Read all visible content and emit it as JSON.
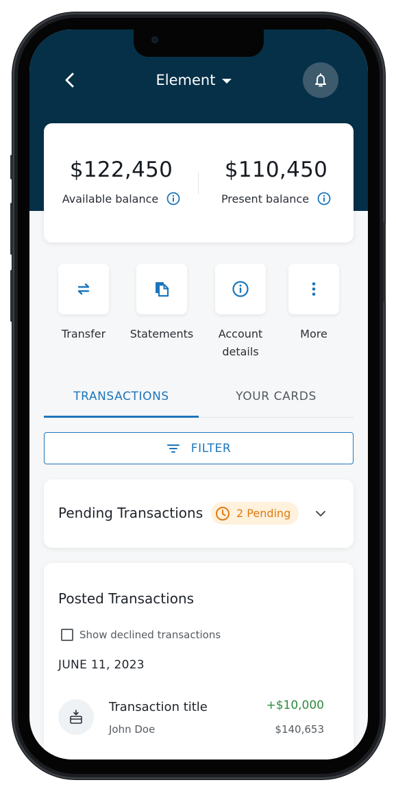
{
  "header": {
    "title": "Element",
    "back_icon": "chevron-left-icon",
    "dropdown_icon": "caret-down-icon",
    "bell_icon": "bell-icon"
  },
  "balances": {
    "available": {
      "amount": "$122,450",
      "label": "Available balance"
    },
    "present": {
      "amount": "$110,450",
      "label": "Present balance"
    }
  },
  "actions": [
    {
      "label": "Transfer",
      "icon": "transfer-arrows-icon"
    },
    {
      "label": "Statements",
      "icon": "documents-icon"
    },
    {
      "label": "Account details",
      "icon": "info-icon"
    },
    {
      "label": "More",
      "icon": "more-vertical-icon"
    }
  ],
  "tabs": [
    {
      "label": "TRANSACTIONS",
      "active": true
    },
    {
      "label": "YOUR CARDS",
      "active": false
    }
  ],
  "filter": {
    "label": "FILTER"
  },
  "pending": {
    "title": "Pending Transactions",
    "badge": "2 Pending"
  },
  "posted": {
    "title": "Posted Transactions",
    "show_declined_label": "Show declined transactions",
    "show_declined_checked": false,
    "date": "JUNE 11, 2023",
    "transactions": [
      {
        "title": "Transaction title",
        "name": "John Doe",
        "amount": "+$10,000",
        "balance": "$140,653"
      }
    ]
  },
  "colors": {
    "header_bg": "#053047",
    "accent": "#1b75bb",
    "positive": "#2e8a3e",
    "pending": "#e07a10"
  }
}
